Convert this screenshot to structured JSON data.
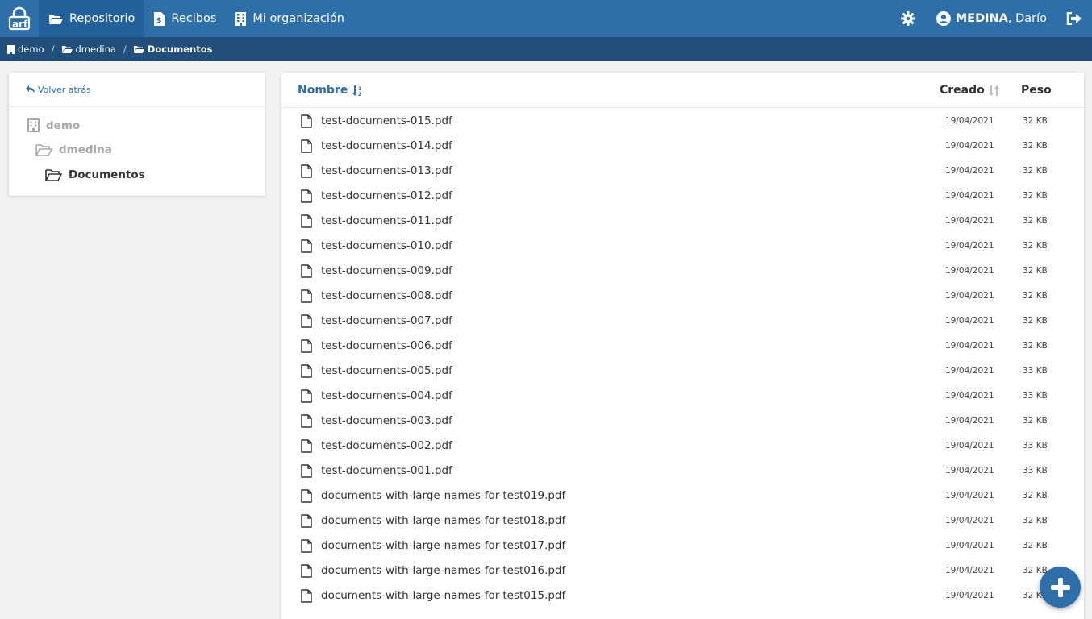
{
  "nav": {
    "logo_text": "arf",
    "items": [
      {
        "label": "Repositorio",
        "icon": "folder-open-icon"
      },
      {
        "label": "Recibos",
        "icon": "receipt-icon"
      },
      {
        "label": "Mi organización",
        "icon": "building-icon"
      }
    ],
    "user": {
      "surname": "MEDINA",
      "given": ", Darío"
    }
  },
  "breadcrumb": [
    "demo",
    "dmedina",
    "Documentos"
  ],
  "sidebar": {
    "back_label": "Volver atrás",
    "tree": [
      "demo",
      "dmedina",
      "Documentos"
    ]
  },
  "table": {
    "columns": {
      "name": "Nombre",
      "created": "Creado",
      "size": "Peso"
    },
    "rows": [
      {
        "name": "test-documents-015.pdf",
        "date": "19/04/2021",
        "size": "32 KB"
      },
      {
        "name": "test-documents-014.pdf",
        "date": "19/04/2021",
        "size": "32 KB"
      },
      {
        "name": "test-documents-013.pdf",
        "date": "19/04/2021",
        "size": "32 KB"
      },
      {
        "name": "test-documents-012.pdf",
        "date": "19/04/2021",
        "size": "32 KB"
      },
      {
        "name": "test-documents-011.pdf",
        "date": "19/04/2021",
        "size": "32 KB"
      },
      {
        "name": "test-documents-010.pdf",
        "date": "19/04/2021",
        "size": "32 KB"
      },
      {
        "name": "test-documents-009.pdf",
        "date": "19/04/2021",
        "size": "32 KB"
      },
      {
        "name": "test-documents-008.pdf",
        "date": "19/04/2021",
        "size": "32 KB"
      },
      {
        "name": "test-documents-007.pdf",
        "date": "19/04/2021",
        "size": "32 KB"
      },
      {
        "name": "test-documents-006.pdf",
        "date": "19/04/2021",
        "size": "32 KB"
      },
      {
        "name": "test-documents-005.pdf",
        "date": "19/04/2021",
        "size": "33 KB"
      },
      {
        "name": "test-documents-004.pdf",
        "date": "19/04/2021",
        "size": "33 KB"
      },
      {
        "name": "test-documents-003.pdf",
        "date": "19/04/2021",
        "size": "32 KB"
      },
      {
        "name": "test-documents-002.pdf",
        "date": "19/04/2021",
        "size": "33 KB"
      },
      {
        "name": "test-documents-001.pdf",
        "date": "19/04/2021",
        "size": "33 KB"
      },
      {
        "name": "documents-with-large-names-for-test019.pdf",
        "date": "19/04/2021",
        "size": "32 KB"
      },
      {
        "name": "documents-with-large-names-for-test018.pdf",
        "date": "19/04/2021",
        "size": "32 KB"
      },
      {
        "name": "documents-with-large-names-for-test017.pdf",
        "date": "19/04/2021",
        "size": "32 KB"
      },
      {
        "name": "documents-with-large-names-for-test016.pdf",
        "date": "19/04/2021",
        "size": "32 KB"
      },
      {
        "name": "documents-with-large-names-for-test015.pdf",
        "date": "19/04/2021",
        "size": "32 KB"
      }
    ]
  },
  "colors": {
    "primary": "#2e6faa",
    "breadcrumb_bg": "#1f4f7a",
    "active_nav": "#24609a"
  }
}
